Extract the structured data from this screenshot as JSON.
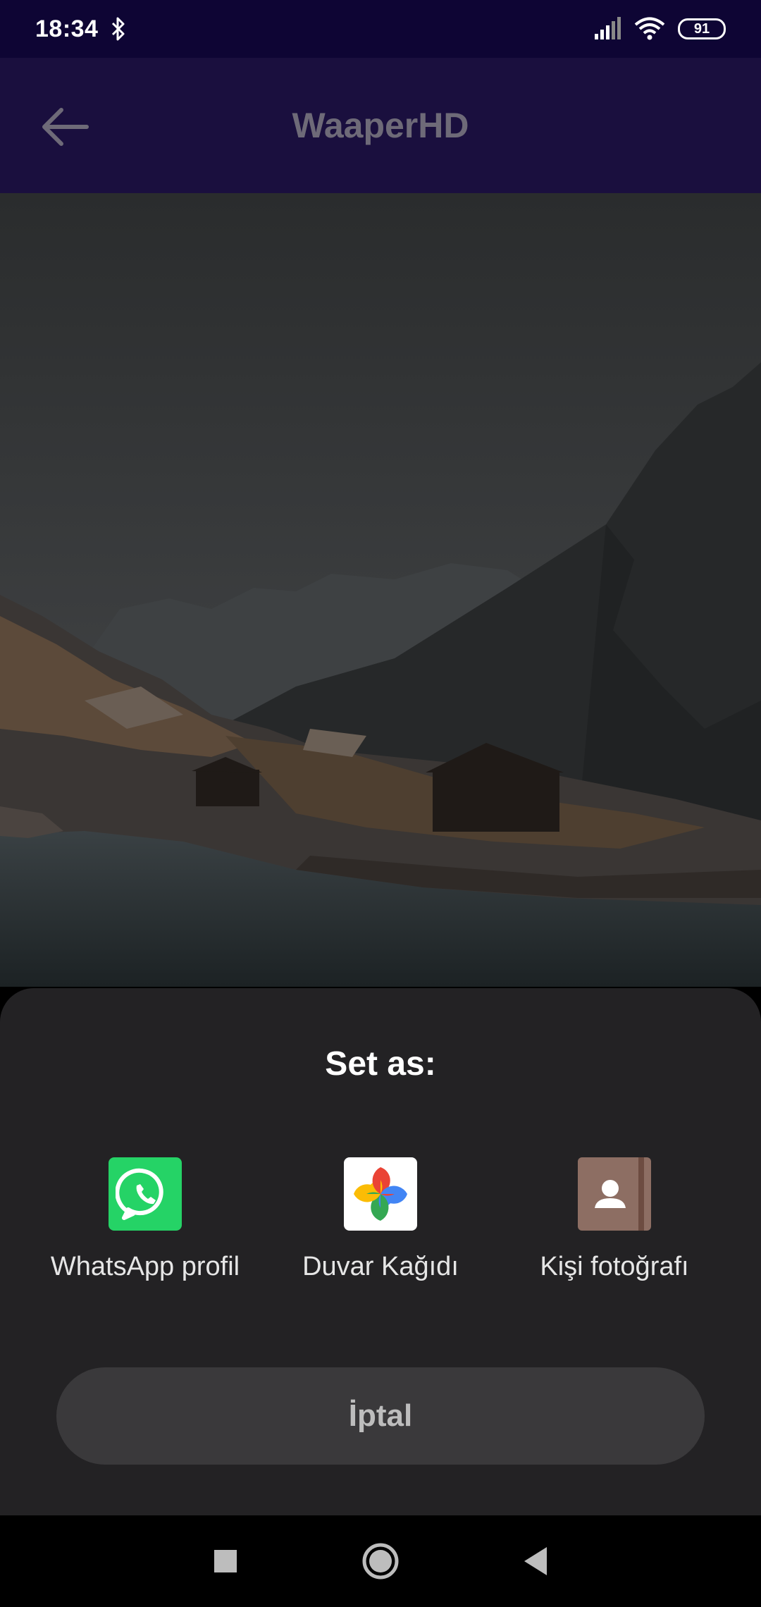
{
  "status_bar": {
    "time": "18:34",
    "battery": "91",
    "icons": [
      "bluetooth-icon",
      "signal-icon",
      "wifi-icon",
      "battery-icon"
    ]
  },
  "app_bar": {
    "title": "WaaperHD",
    "back_icon": "arrow-left-icon"
  },
  "sheet": {
    "title": "Set as:",
    "apps": [
      {
        "label": "WhatsApp profil",
        "icon": "whatsapp-icon"
      },
      {
        "label": "Duvar Kağıdı",
        "icon": "google-photos-icon"
      },
      {
        "label": "Kişi fotoğrafı",
        "icon": "contacts-icon"
      }
    ],
    "cancel_label": "İptal"
  },
  "nav_bar": {
    "icons": [
      "recents-square-icon",
      "home-circle-icon",
      "back-triangle-icon"
    ]
  },
  "colors": {
    "status_bar_bg": "#0e0534",
    "app_bar_bg": "#1a0f3e",
    "sheet_bg": "#232224",
    "cancel_bg": "#3a393b",
    "whatsapp_green": "#25d366",
    "contacts_brown": "#8d6e63"
  }
}
